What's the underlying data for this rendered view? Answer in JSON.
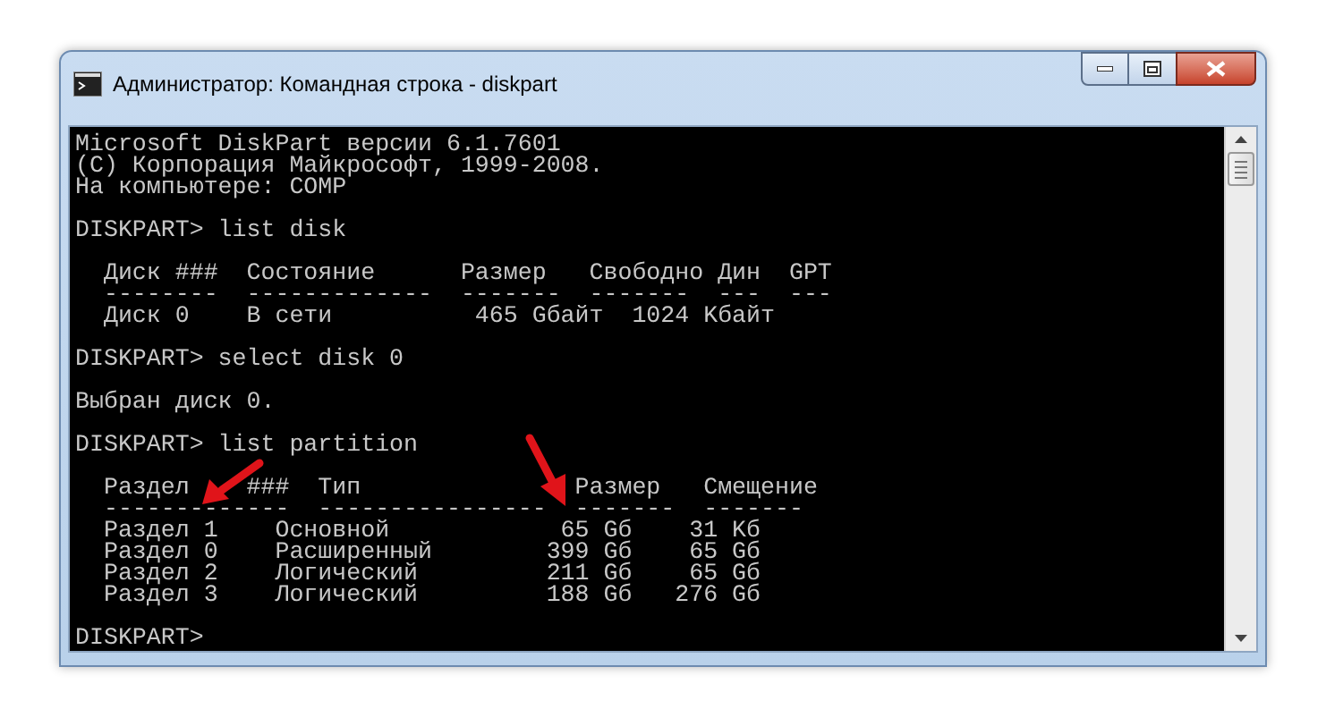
{
  "window": {
    "title": "Администратор: Командная строка - diskpart"
  },
  "console": {
    "blocks": [
      {
        "lines": [
          "Microsoft DiskPart версии 6.1.7601",
          "(C) Корпорация Майкрософт, 1999-2008.",
          "На компьютере: COMP"
        ]
      },
      {
        "lines": [
          "DISKPART> list disk"
        ]
      },
      {
        "lines": [
          "  Диск ###  Состояние      Размер   Свободно Дин  GPT",
          "  --------  -------------  -------  -------  ---  ---",
          "  Диск 0    В сети          465 Gбайт  1024 Kбайт"
        ]
      },
      {
        "lines": [
          "DISKPART> select disk 0"
        ]
      },
      {
        "lines": [
          "Выбран диск 0."
        ]
      },
      {
        "lines": [
          "DISKPART> list partition"
        ]
      },
      {
        "lines": [
          "  Раздел    ###  Тип               Размер   Смещение",
          "  -------------  ----------------  -------  -------",
          "  Раздел 1    Основной            65 Gб    31 Kб",
          "  Раздел 0    Расширенный        399 Gб    65 Gб",
          "  Раздел 2    Логический         211 Gб    65 Gб",
          "  Раздел 3    Логический         188 Gб   276 Gб"
        ]
      },
      {
        "lines": [
          "DISKPART>"
        ]
      }
    ]
  }
}
